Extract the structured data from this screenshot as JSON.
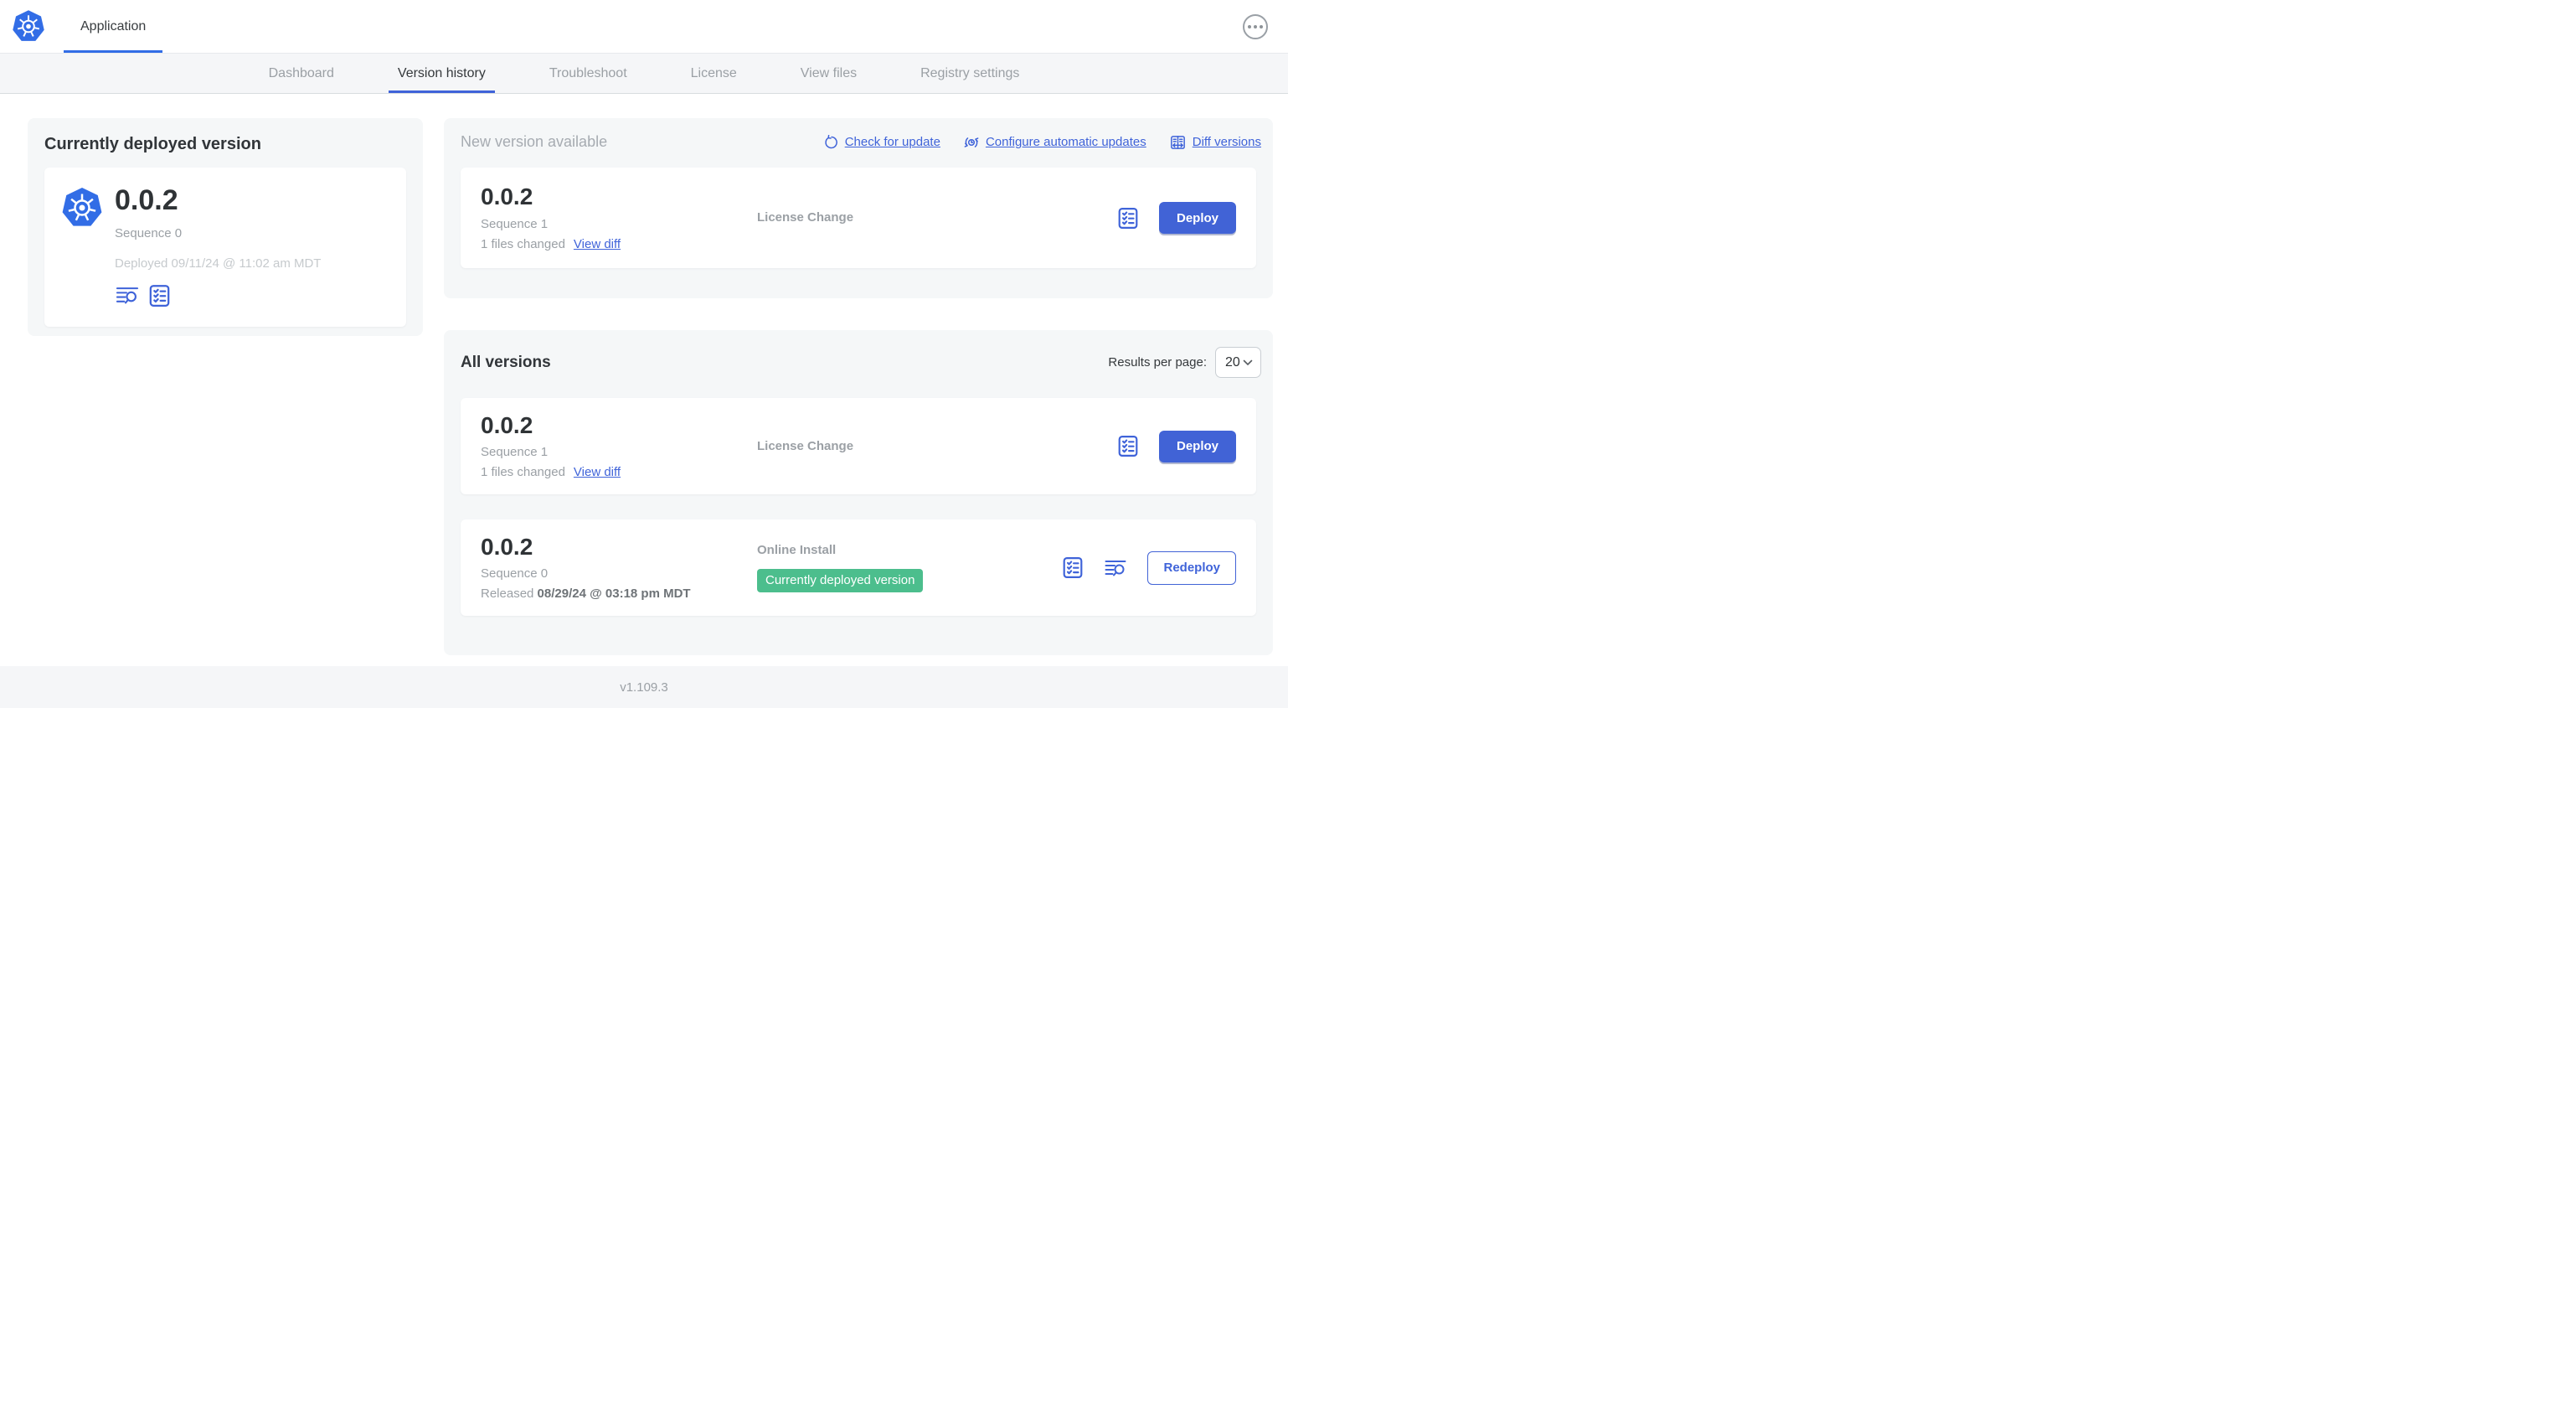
{
  "colors": {
    "accent_blue": "#3F63D9",
    "button_blue": "#4163D6",
    "logo_blue": "#326DE6",
    "badge_green": "#4CBE8D",
    "panel_bg": "#F5F7F8"
  },
  "icons": {
    "logo": "kubernetes-logo-icon",
    "more": "ellipsis-menu-icon",
    "check_update": "refresh-icon",
    "auto_update": "schedule-sync-icon",
    "diff": "diff-columns-icon",
    "release_notes": "lines-magnifier-icon",
    "config": "checklist-icon",
    "select_chevron": "chevron-down-icon"
  },
  "header": {
    "app_tab": "Application"
  },
  "nav": {
    "tabs": [
      {
        "label": "Dashboard"
      },
      {
        "label": "Version history"
      },
      {
        "label": "Troubleshoot"
      },
      {
        "label": "License"
      },
      {
        "label": "View files"
      },
      {
        "label": "Registry settings"
      }
    ]
  },
  "deployed_panel": {
    "title": "Currently deployed version",
    "version": "0.0.2",
    "sequence": "Sequence 0",
    "deployed_at": "Deployed 09/11/24 @ 11:02 am MDT"
  },
  "new_version_panel": {
    "title": "New version available",
    "actions": [
      {
        "label": "Check for update"
      },
      {
        "label": "Configure automatic updates"
      },
      {
        "label": "Diff versions"
      }
    ],
    "card": {
      "version": "0.0.2",
      "sequence": "Sequence 1",
      "files_changed": "1 files changed",
      "view_diff": "View diff",
      "source": "License Change",
      "deploy_label": "Deploy"
    }
  },
  "all_versions_panel": {
    "title": "All versions",
    "results_per_page_label": "Results per page:",
    "per_page_value": "20",
    "rows": [
      {
        "version": "0.0.2",
        "sequence": "Sequence 1",
        "files_changed": "1 files changed",
        "view_diff": "View diff",
        "source": "License Change",
        "action_label": "Deploy"
      },
      {
        "version": "0.0.2",
        "sequence": "Sequence 0",
        "released_prefix": "Released ",
        "released_at": "08/29/24 @ 03:18 pm MDT",
        "source": "Online Install",
        "badge": "Currently deployed version",
        "action_label": "Redeploy"
      }
    ]
  },
  "footer": {
    "app_version": "v1.109.3"
  }
}
